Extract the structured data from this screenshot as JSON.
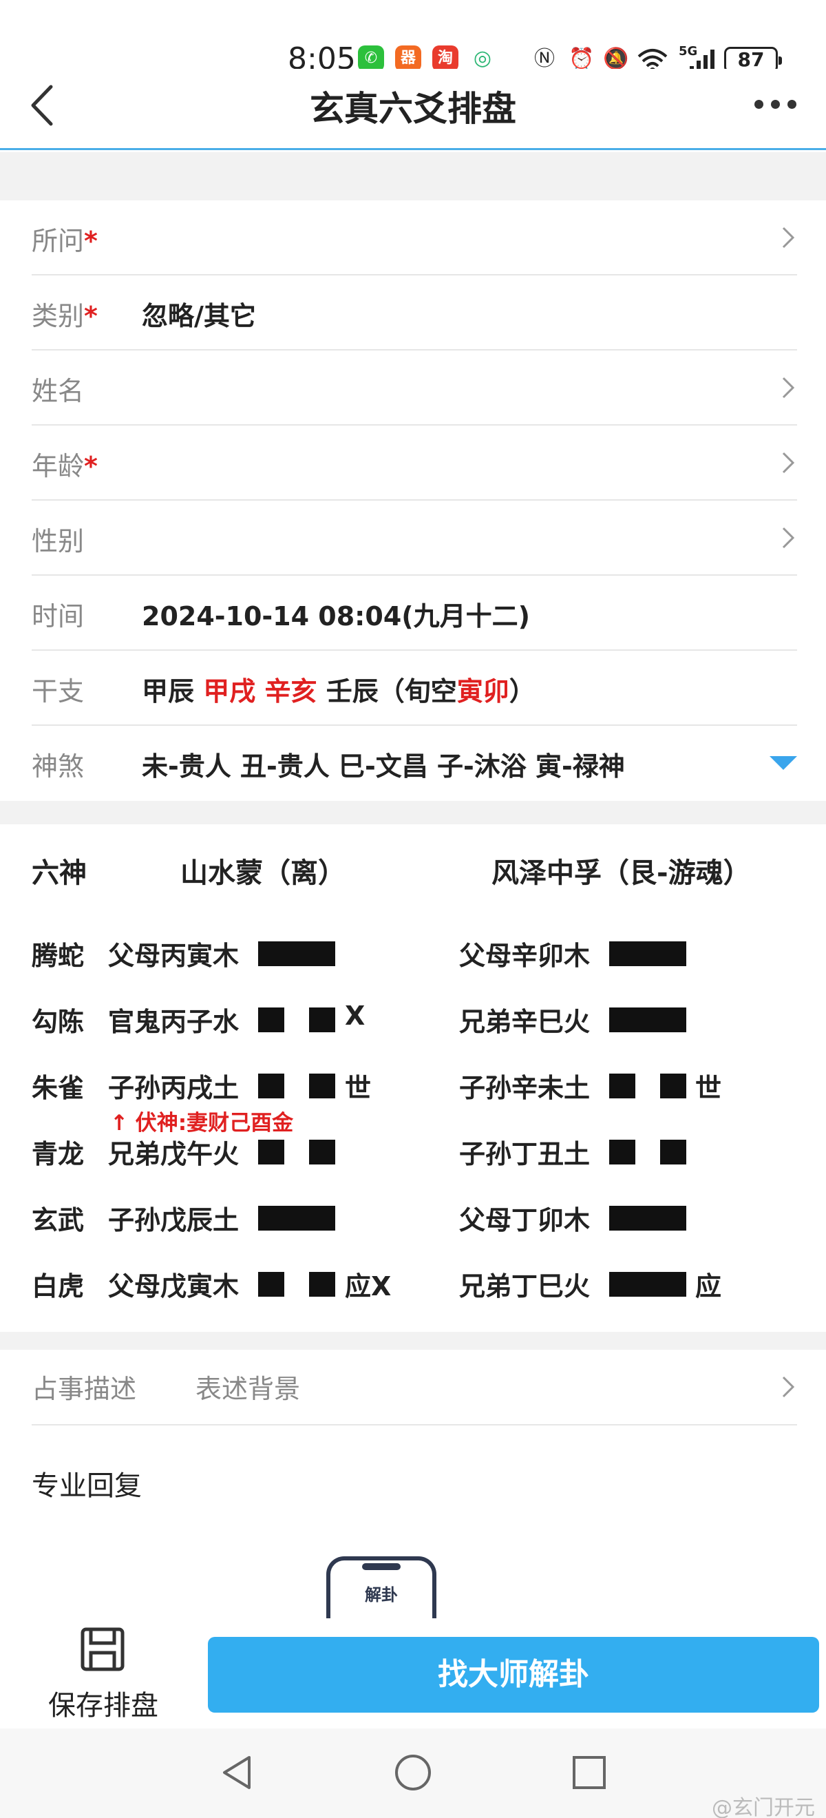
{
  "status_bar": {
    "time": "8:05",
    "battery": "87",
    "network": "5G",
    "apps": [
      {
        "icon": "wechat-icon",
        "glyph": "✆",
        "color": "#2cc03c"
      },
      {
        "icon": "app-icon-orange",
        "glyph": "器",
        "color": "#f36a22"
      },
      {
        "icon": "taobao-icon",
        "glyph": "淘",
        "color": "#e93b2d"
      },
      {
        "icon": "green-swirl-icon",
        "glyph": "◎",
        "color": "#2bb673"
      }
    ]
  },
  "header": {
    "title": "玄真六爻排盘"
  },
  "form": {
    "wen": {
      "label": "所问",
      "required": "*"
    },
    "category": {
      "label": "类别",
      "required": "*",
      "value": "忽略/其它"
    },
    "name": {
      "label": "姓名"
    },
    "age": {
      "label": "年龄",
      "required": "*"
    },
    "gender": {
      "label": "性别"
    },
    "time": {
      "label": "时间",
      "value": "2024-10-14 08:04(九月十二)"
    },
    "ganzhi": {
      "label": "干支",
      "year": "甲辰",
      "month": "甲戌",
      "day": "辛亥",
      "hour": "壬辰",
      "xunkong_prefix": "（旬空",
      "xunkong": "寅卯",
      "xunkong_suffix": "）"
    },
    "shensha": {
      "label": "神煞",
      "value": "未-贵人 丑-贵人 巳-文昌 子-沐浴 寅-禄神"
    }
  },
  "hexagram": {
    "col_spirit": "六神",
    "main_name": "山水蒙（离）",
    "changed_name": "风泽中孚（艮-游魂）",
    "fushen": "↑ 伏神:妻财己酉金",
    "rows": [
      {
        "spirit": "腾蛇",
        "main": "父母丙寅木",
        "main_mark": "",
        "changed": "父母辛卯木",
        "changed_mark": ""
      },
      {
        "spirit": "勾陈",
        "main": "官鬼丙子水",
        "main_mark": "X",
        "changed": "兄弟辛巳火",
        "changed_mark": ""
      },
      {
        "spirit": "朱雀",
        "main": "子孙丙戌土",
        "main_mark": "世",
        "changed": "子孙辛未土",
        "changed_mark": "世"
      },
      {
        "spirit": "青龙",
        "main": "兄弟戊午火",
        "main_mark": "",
        "changed": "子孙丁丑土",
        "changed_mark": ""
      },
      {
        "spirit": "玄武",
        "main": "子孙戊辰土",
        "main_mark": "",
        "changed": "父母丁卯木",
        "changed_mark": ""
      },
      {
        "spirit": "白虎",
        "main": "父母戊寅木",
        "main_mark": "应X",
        "changed": "兄弟丁巳火",
        "changed_mark": "应"
      }
    ],
    "main_lines": [
      "yang",
      "yin",
      "yin",
      "yin",
      "yang",
      "yin"
    ],
    "changed_lines": [
      "yang",
      "yang",
      "yin",
      "yin",
      "yang",
      "yang"
    ]
  },
  "description": {
    "label": "占事描述",
    "placeholder": "表述背景"
  },
  "reply": {
    "title": "专业回复",
    "illustration_text": "解卦"
  },
  "bottom": {
    "save_label": "保存排盘",
    "find_master": "找大师解卦"
  },
  "watermark": "@玄门开元"
}
